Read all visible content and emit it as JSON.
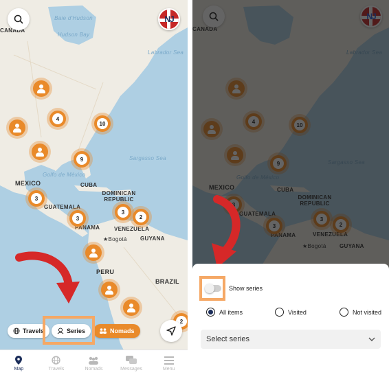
{
  "colors": {
    "accent": "#e98a2a",
    "brand_navy": "#1b2d5a",
    "highlight": "#f5a865",
    "annotation_red": "#d62828"
  },
  "user": {
    "initials": "NJ"
  },
  "map": {
    "labels": {
      "canada": "CANADA",
      "hudson": "Hudson Bay",
      "baie": "Baie d'Hudson",
      "labrador": "Labrador Sea",
      "sargasso": "Sargasso Sea",
      "golfo": "Golfo de México",
      "mexico": "MEXICO",
      "cuba": "CUBA",
      "dominican": "DOMINICAN REPUBLIC",
      "guatemala": "GUATEMALA",
      "panama": "PANAMA",
      "venezuela": "VENEZUELA",
      "bogota": "★Bogotá",
      "guyana": "GUYANA",
      "peru": "PERU",
      "brazil": "BRAZIL"
    },
    "clusters": [
      "4",
      "10",
      "9",
      "3",
      "3",
      "3",
      "2",
      "2"
    ]
  },
  "left": {
    "chips": {
      "travels": "Travels",
      "series": "Series",
      "nomads": "Nomads"
    },
    "tabs": [
      "Map",
      "Travels",
      "Nomads",
      "Messages",
      "Menu"
    ]
  },
  "right": {
    "show_series": "Show series",
    "radios": [
      "All items",
      "Visited",
      "Not visited"
    ],
    "selected_radio": "All items",
    "select_placeholder": "Select series"
  },
  "icons": [
    "search-icon",
    "user-avatar",
    "globe-icon",
    "series-icon",
    "nomads-icon",
    "navigate-icon",
    "map-pin-icon",
    "chevron-down-icon"
  ]
}
